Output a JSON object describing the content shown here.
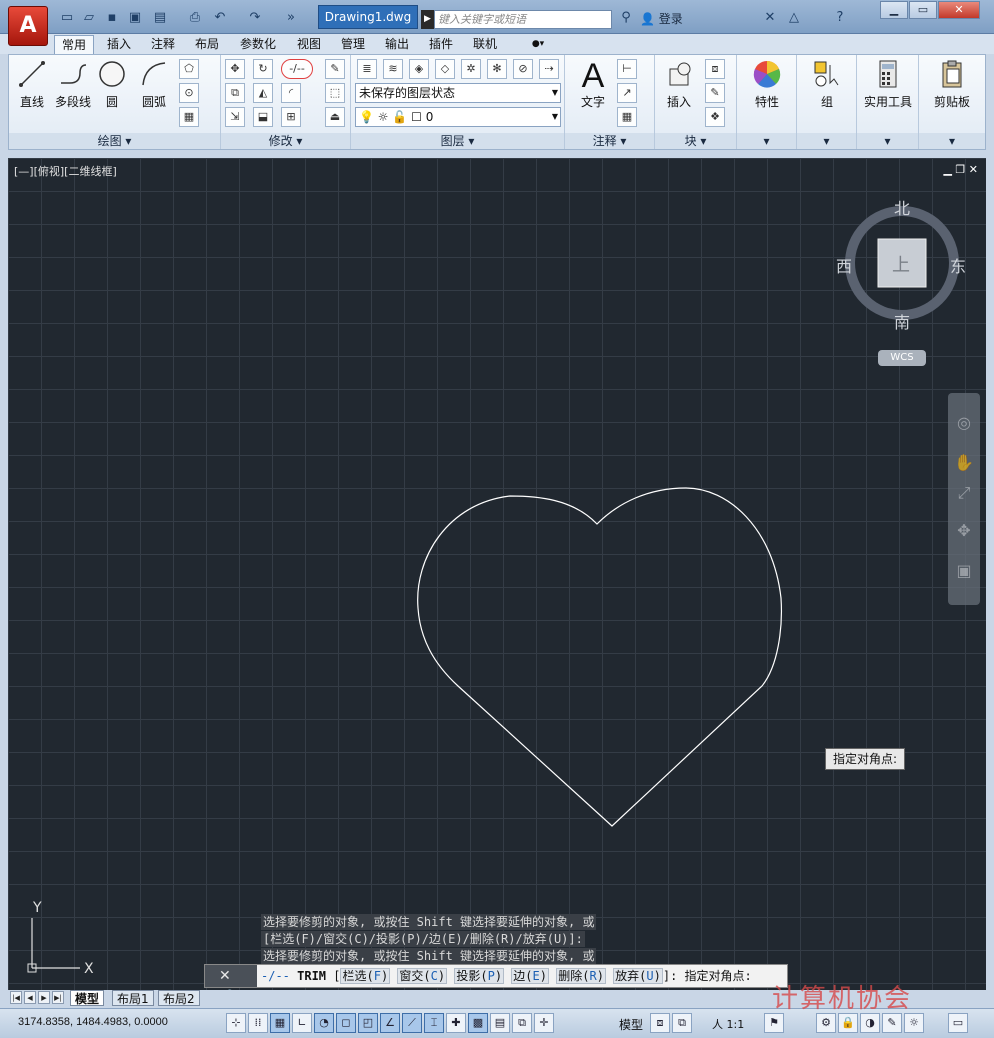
{
  "app": {
    "logo": "A",
    "document_title": "Drawing1.dwg"
  },
  "titlebar": {
    "search_placeholder": "键入关键字或短语",
    "sign_in": "登录",
    "win_min": "▁",
    "win_max": "▭",
    "win_close": "✕"
  },
  "ribbon_tabs": [
    "常用",
    "插入",
    "注释",
    "布局",
    "参数化",
    "视图",
    "管理",
    "输出",
    "插件",
    "联机"
  ],
  "panels": {
    "draw": {
      "title": "绘图",
      "buttons": [
        "直线",
        "多段线",
        "圆",
        "圆弧"
      ]
    },
    "modify": {
      "title": "修改"
    },
    "layer": {
      "title": "图层",
      "layer_state": "未保存的图层状态",
      "current_layer": "0"
    },
    "annotation": {
      "title": "注释",
      "text_label": "文字",
      "text_glyph": "A"
    },
    "block": {
      "title": "块",
      "insert_label": "插入"
    },
    "properties": {
      "label": "特性"
    },
    "group": {
      "label": "组"
    },
    "utilities": {
      "label": "实用工具"
    },
    "clipboard": {
      "label": "剪贴板"
    }
  },
  "viewport": {
    "label": "[—][俯视][二维线框]",
    "controls": "▁ ❐ ✕",
    "compass": {
      "north": "北",
      "south": "南",
      "east": "东",
      "west": "西",
      "top_face": "上"
    },
    "wcs": "WCS",
    "tooltip": "指定对角点:",
    "ucs_x": "X",
    "ucs_y": "Y"
  },
  "command": {
    "history": [
      "选择要修剪的对象, 或按住 Shift 键选择要延伸的对象, 或",
      "[栏选(F)/窗交(C)/投影(P)/边(E)/删除(R)/放弃(U)]:",
      "选择要修剪的对象, 或按住 Shift 键选择要延伸的对象, 或"
    ],
    "current_cmd": "TRIM",
    "options": [
      {
        "label": "栏选(",
        "key": "F",
        "end": ")"
      },
      {
        "label": "窗交(",
        "key": "C",
        "end": ")"
      },
      {
        "label": "投影(",
        "key": "P",
        "end": ")"
      },
      {
        "label": "边(",
        "key": "E",
        "end": ")"
      },
      {
        "label": "删除(",
        "key": "R",
        "end": ")"
      },
      {
        "label": "放弃(",
        "key": "U",
        "end": ")"
      }
    ],
    "prompt": "]: 指定对角点:"
  },
  "layout_tabs": [
    "模型",
    "布局1",
    "布局2"
  ],
  "status": {
    "coords": "3174.8358, 1484.4983, 0.0000",
    "model": "模型",
    "scale": "人 1:1"
  },
  "watermark": "计算机协会",
  "colors": {
    "canvas_bg": "#212830",
    "grid": "#343c46",
    "heart_stroke": "#ffffff",
    "accent": "#2f6fb8",
    "trim_highlight": "#e04040"
  }
}
